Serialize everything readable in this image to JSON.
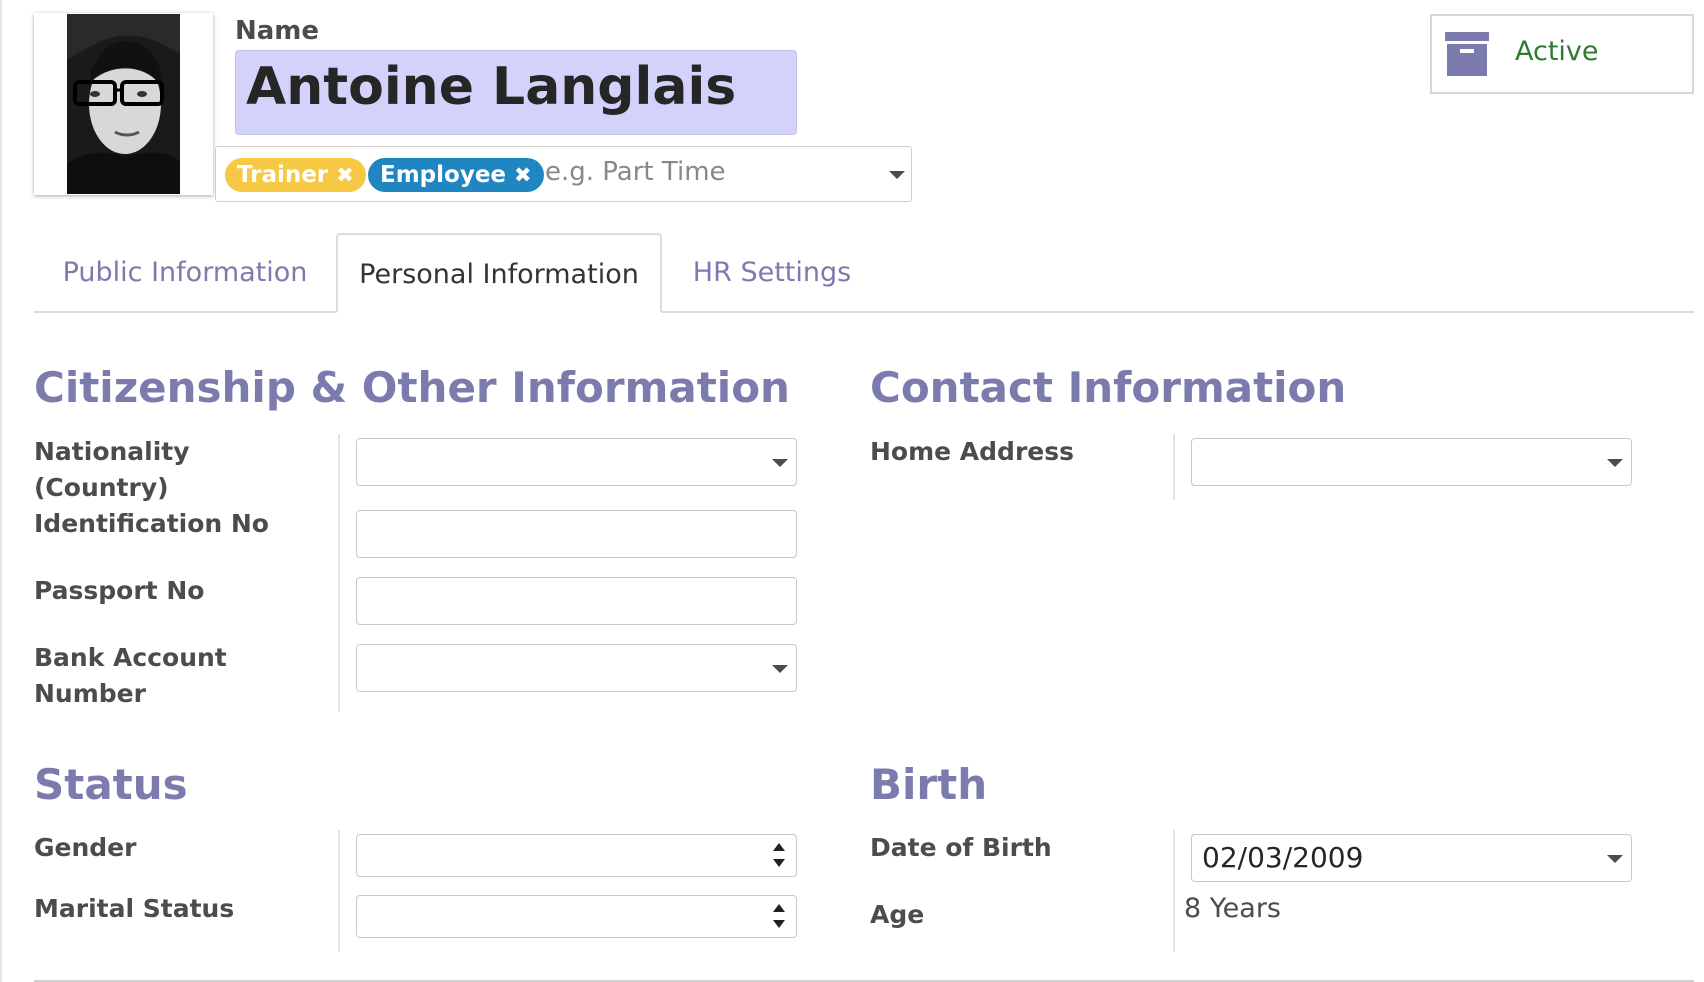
{
  "header": {
    "name_label": "Name",
    "name_value": "Antoine Langlais",
    "tags": [
      {
        "label": "Trainer",
        "color": "#f6c844"
      },
      {
        "label": "Employee",
        "color": "#1f86c1"
      }
    ],
    "tags_placeholder": "e.g. Part Time",
    "active_button": {
      "label": "Active",
      "icon": "archive-icon",
      "color": "#2f7b2f"
    }
  },
  "tabs": [
    {
      "label": "Public Information",
      "active": false
    },
    {
      "label": "Personal Information",
      "active": true
    },
    {
      "label": "HR Settings",
      "active": false
    }
  ],
  "citizenship": {
    "title": "Citizenship & Other Information",
    "nationality_label": "Nationality (Country)",
    "identification_label": "Identification No",
    "passport_label": "Passport No",
    "bank_label": "Bank Account Number"
  },
  "contact": {
    "title": "Contact Information",
    "home_address_label": "Home Address"
  },
  "status": {
    "title": "Status",
    "gender_label": "Gender",
    "marital_label": "Marital Status"
  },
  "birth": {
    "title": "Birth",
    "dob_label": "Date of Birth",
    "dob_value": "02/03/2009",
    "age_label": "Age",
    "age_value": "8 Years"
  },
  "colors": {
    "accent": "#7c7bad",
    "name_field_bg": "#d2d2fa"
  }
}
